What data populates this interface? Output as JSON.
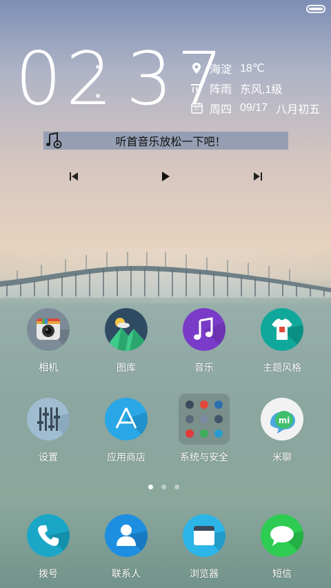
{
  "clock": {
    "time": "02:37",
    "hours": "02",
    "minutes": "37"
  },
  "weather": {
    "location": "海淀",
    "temperature": "18℃",
    "condition": "阵雨",
    "wind": "东风,1级",
    "weekday": "周四",
    "date": "09/17",
    "lunar": "八月初五",
    "calendar_day": "27"
  },
  "music": {
    "prompt": "听首音乐放松一下吧！"
  },
  "apps": [
    {
      "label": "相机"
    },
    {
      "label": "图库"
    },
    {
      "label": "音乐"
    },
    {
      "label": "主题风格"
    },
    {
      "label": "设置"
    },
    {
      "label": "应用商店"
    },
    {
      "label": "系统与安全"
    },
    {
      "label": "米聊"
    }
  ],
  "dock": [
    {
      "label": "拨号"
    },
    {
      "label": "联系人"
    },
    {
      "label": "浏览器"
    },
    {
      "label": "短信"
    }
  ],
  "pager": {
    "current_page": 1,
    "total_pages": 3
  },
  "colors": {
    "music_app": "#7a3cc8",
    "theme_app": "#10a89a",
    "settings_app": "#9fbcd0",
    "store_app": "#29a7e6",
    "dial_app": "#1aa7c7",
    "contacts_app": "#1e8fe0",
    "browser_app": "#2bb5e8",
    "sms_app": "#2ecc52"
  }
}
